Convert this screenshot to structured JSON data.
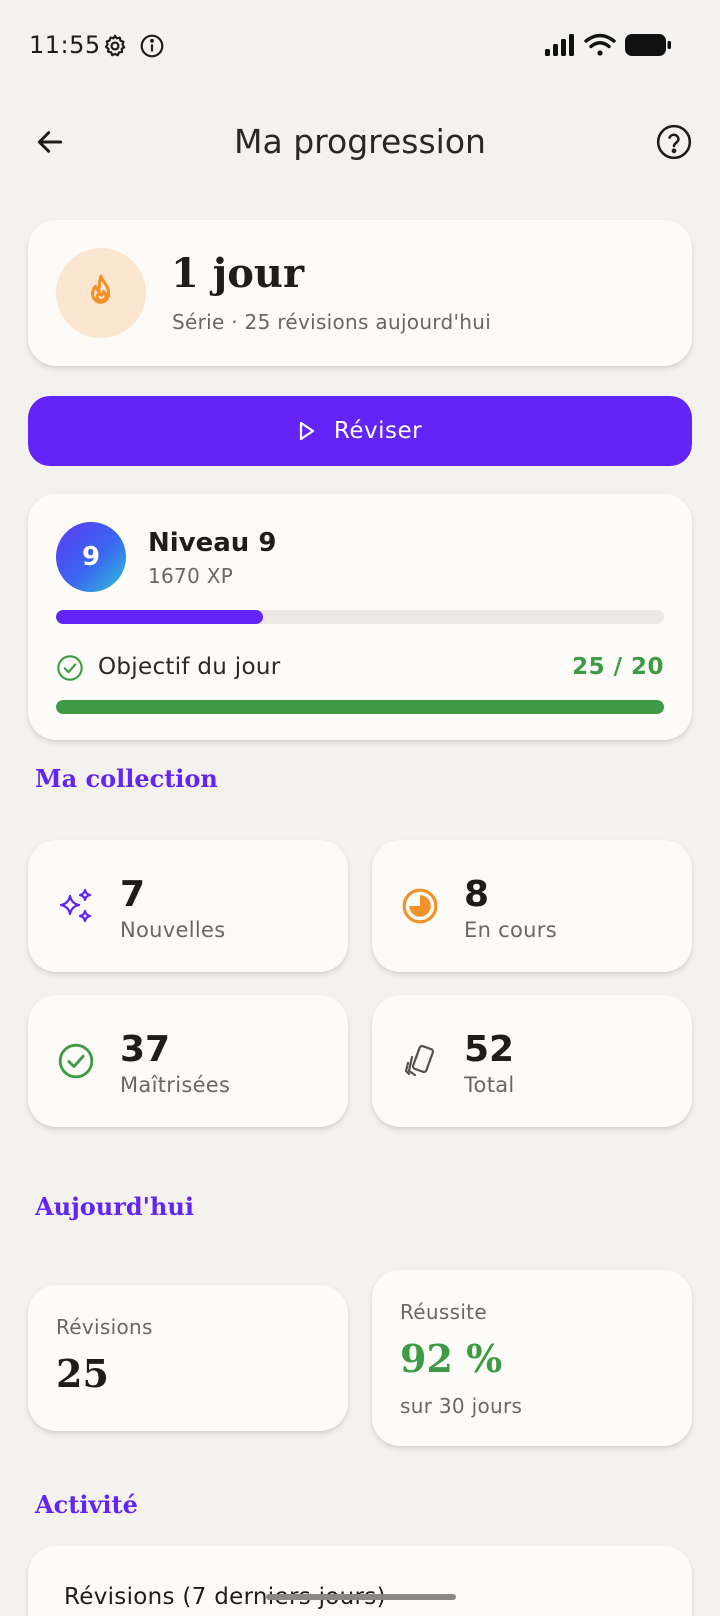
{
  "status_bar": {
    "time": "11:55"
  },
  "header": {
    "title": "Ma progression"
  },
  "streak": {
    "value": "1 jour",
    "subtitle": "Série · 25 révisions aujourd'hui"
  },
  "review_button": {
    "label": "Réviser"
  },
  "level": {
    "badge": "9",
    "title": "Niveau 9",
    "xp": "1670 XP",
    "xp_progress": 0.34,
    "goal_label": "Objectif du jour",
    "goal_value": "25 / 20",
    "goal_progress": 1.0
  },
  "collection": {
    "title": "Ma collection",
    "items": [
      {
        "value": "7",
        "label": "Nouvelles",
        "icon": "sparkles-icon"
      },
      {
        "value": "8",
        "label": "En cours",
        "icon": "half-circle-icon"
      },
      {
        "value": "37",
        "label": "Maîtrisées",
        "icon": "check-circle-icon"
      },
      {
        "value": "52",
        "label": "Total",
        "icon": "cards-icon"
      }
    ]
  },
  "today": {
    "title": "Aujourd'hui",
    "reviews_label": "Révisions",
    "reviews_value": "25",
    "success_label": "Réussite",
    "success_value": "92 %",
    "success_sub": "sur 30 jours"
  },
  "activity": {
    "title": "Activité",
    "chart_title": "Révisions (7 derniers jours)"
  },
  "colors": {
    "accent": "#6325F7",
    "success": "#3F9A45",
    "flame": "#F2912A",
    "background": "#F4F2EE",
    "card": "#FCFBF8"
  }
}
